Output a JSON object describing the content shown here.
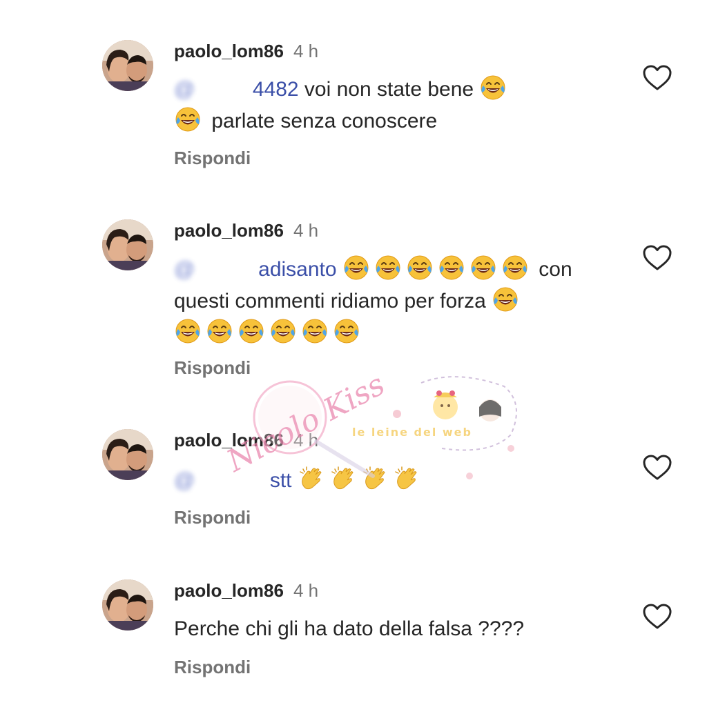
{
  "comments": [
    {
      "username": "paolo_lom86",
      "time": "4 h",
      "mention_visible": "4482",
      "text_1": " voi non state bene ",
      "text_2": " parlate senza conoscere",
      "reply": "Rispondi"
    },
    {
      "username": "paolo_lom86",
      "time": "4 h",
      "mention_visible": "adisanto",
      "text_1": " con questi commenti ridiamo per forza ",
      "reply": "Rispondi"
    },
    {
      "username": "paolo_lom86",
      "time": "4 h",
      "mention_visible": "stt",
      "reply": "Rispondi"
    },
    {
      "username": "paolo_lom86",
      "time": "4 h",
      "text_1": "Perche chi gli ha dato della falsa ????",
      "reply": "Rispondi"
    }
  ],
  "watermark": {
    "signature": "Nicolo Kiss",
    "tagline": "le leine del web"
  },
  "icons": {
    "like": "heart-icon",
    "laughing": "face-with-tears-of-joy-icon",
    "clapping": "clapping-hands-icon"
  },
  "colors": {
    "username": "#262626",
    "time": "#737373",
    "mention": "#3b4fa8",
    "reply": "#737373"
  }
}
